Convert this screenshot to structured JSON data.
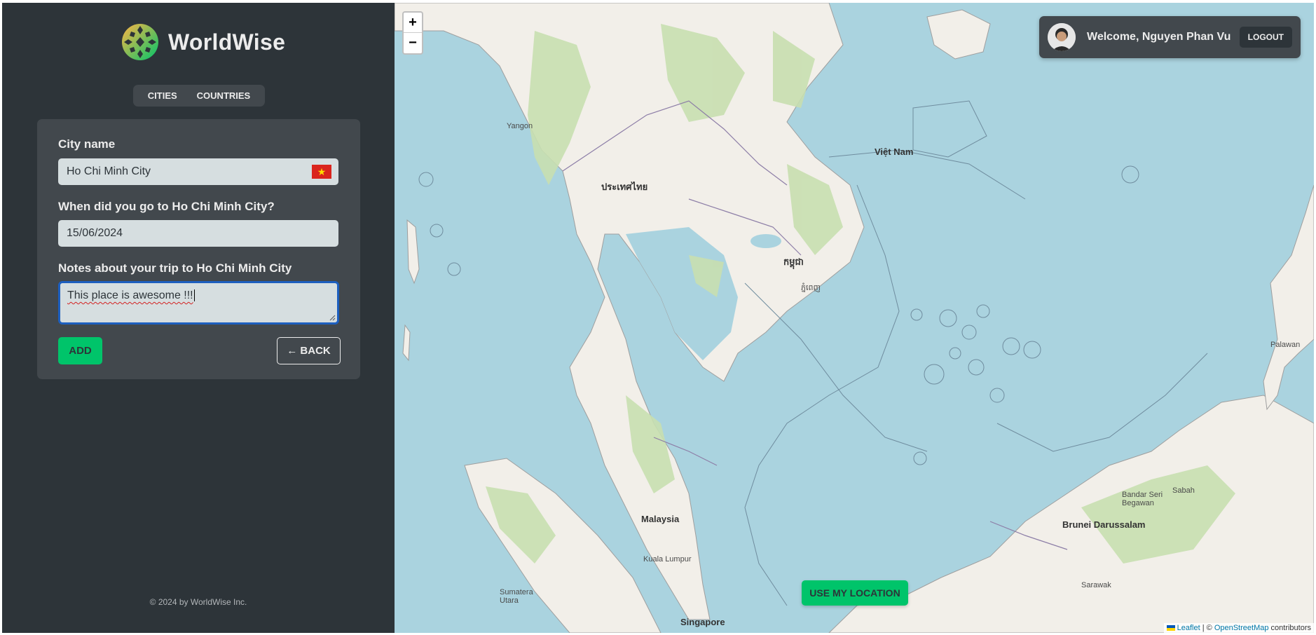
{
  "brand": {
    "name": "WorldWise"
  },
  "tabs": [
    {
      "label": "CITIES"
    },
    {
      "label": "COUNTRIES"
    }
  ],
  "form": {
    "city_label": "City name",
    "city_value": "Ho Chi Minh City",
    "flag": "🇻🇳",
    "date_label": "When did you go to Ho Chi Minh City?",
    "date_value": "15/06/2024",
    "notes_label": "Notes about your trip to Ho Chi Minh City",
    "notes_value": "This place is awesome !!!",
    "add_label": "ADD",
    "back_label": "← BACK"
  },
  "footer": {
    "text": "© 2024 by WorldWise Inc."
  },
  "map": {
    "zoom_in": "+",
    "zoom_out": "−",
    "locate_label": "USE MY LOCATION",
    "attribution_leaflet": "Leaflet",
    "attribution_sep": " | © ",
    "attribution_osm": "OpenStreetMap",
    "attribution_tail": " contributors",
    "labels": [
      {
        "text": "ประเทศไทย",
        "big": true
      },
      {
        "text": "Việt Nam",
        "big": true
      },
      {
        "text": "កម្ពុជា",
        "big": true
      },
      {
        "text": "Malaysia",
        "big": true
      },
      {
        "text": "Singapore",
        "big": true
      },
      {
        "text": "Brunei Darussalam",
        "big": true
      },
      {
        "text": "Kuala Lumpur",
        "big": false
      },
      {
        "text": "Bandar Seri Begawan",
        "big": false
      },
      {
        "text": "ភ្នំពេញ",
        "big": false
      },
      {
        "text": "Yangon",
        "big": false
      },
      {
        "text": "Sumatera Utara",
        "big": false
      },
      {
        "text": "Sarawak",
        "big": false
      },
      {
        "text": "Sabah",
        "big": false
      },
      {
        "text": "Palawan",
        "big": false
      }
    ]
  },
  "user": {
    "welcome": "Welcome, Nguyen Phan Vu",
    "logout_label": "LOGOUT"
  },
  "colors": {
    "sidebar_bg": "#2d3439",
    "panel_bg": "#42484d",
    "accent_green": "#00c46a",
    "input_bg": "#d6dee0",
    "sea": "#aad3df",
    "land": "#f2efe9",
    "forest": "#c8dfb0"
  }
}
